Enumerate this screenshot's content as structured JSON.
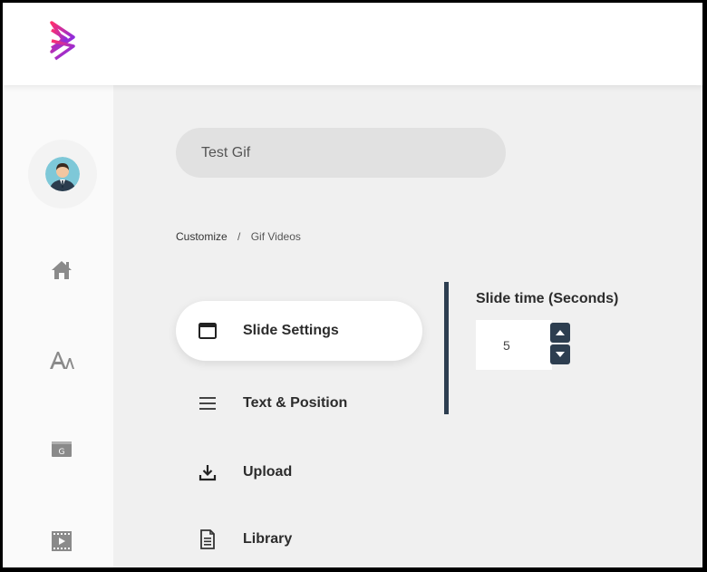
{
  "header": {
    "logo_icon": "play-arrow-logo",
    "accent_from": "#ff2f6d",
    "accent_to": "#6a2cff"
  },
  "sidebar": {
    "items": [
      {
        "name": "user-avatar",
        "icon": "avatar"
      },
      {
        "name": "home",
        "icon": "home-icon"
      },
      {
        "name": "fonts",
        "icon": "font-icon"
      },
      {
        "name": "gif",
        "icon": "gif-icon"
      },
      {
        "name": "video",
        "icon": "video-icon"
      }
    ]
  },
  "project": {
    "name_value": "Test Gif"
  },
  "breadcrumb": {
    "parent": "Customize",
    "separator": "/",
    "current": "Gif Videos"
  },
  "menu": {
    "items": [
      {
        "label": "Slide Settings",
        "icon": "window-icon",
        "active": true
      },
      {
        "label": "Text & Position",
        "icon": "hamburger-icon",
        "active": false
      },
      {
        "label": "Upload",
        "icon": "download-icon",
        "active": false
      },
      {
        "label": "Library",
        "icon": "document-icon",
        "active": false
      }
    ]
  },
  "slide_settings": {
    "label": "Slide time (Seconds)",
    "value": "5"
  },
  "colors": {
    "panel_dark": "#2d3e50",
    "background": "#f0f0f0"
  }
}
